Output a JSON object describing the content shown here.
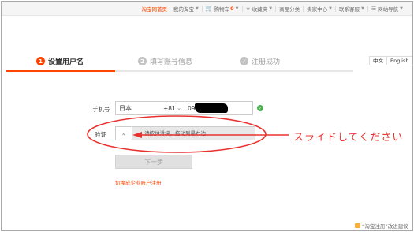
{
  "topnav": {
    "items": [
      {
        "label": "淘宝网首页"
      },
      {
        "label": "我的淘宝",
        "dropdown": true
      },
      {
        "label": "购物车",
        "count": "0",
        "dropdown": true,
        "icon": "cart-icon"
      },
      {
        "label": "收藏夹",
        "dropdown": true,
        "icon": "star-icon"
      },
      {
        "label": "商品分类"
      },
      {
        "label": "卖家中心",
        "dropdown": true
      },
      {
        "label": "联系客服",
        "dropdown": true
      },
      {
        "label": "网站导航",
        "dropdown": true,
        "icon": "menu-icon"
      }
    ]
  },
  "steps": [
    {
      "num": "1",
      "label": "设置用户名",
      "state": "active"
    },
    {
      "num": "2",
      "label": "填写账号信息",
      "state": "inactive"
    },
    {
      "num": "✓",
      "label": "注册成功",
      "state": "inactive"
    }
  ],
  "language": {
    "zh": "中文",
    "en": "English"
  },
  "form": {
    "phone_label": "手机号",
    "country": "日本",
    "country_code": "+81",
    "phone_value": "09",
    "verify_label": "验证",
    "slider_handle": "»",
    "slider_text": "请按住滑块，拖动到最右边",
    "next_button": "下一步",
    "enterprise_link": "切换成企业账户注册"
  },
  "annotation": {
    "text": "スライドしてください",
    "color": "#e8322f"
  },
  "feedback": {
    "label": "“淘宝注册”改进建议"
  },
  "colors": {
    "accent": "#ff4400",
    "success": "#4caf50",
    "annotation": "#e8322f"
  }
}
